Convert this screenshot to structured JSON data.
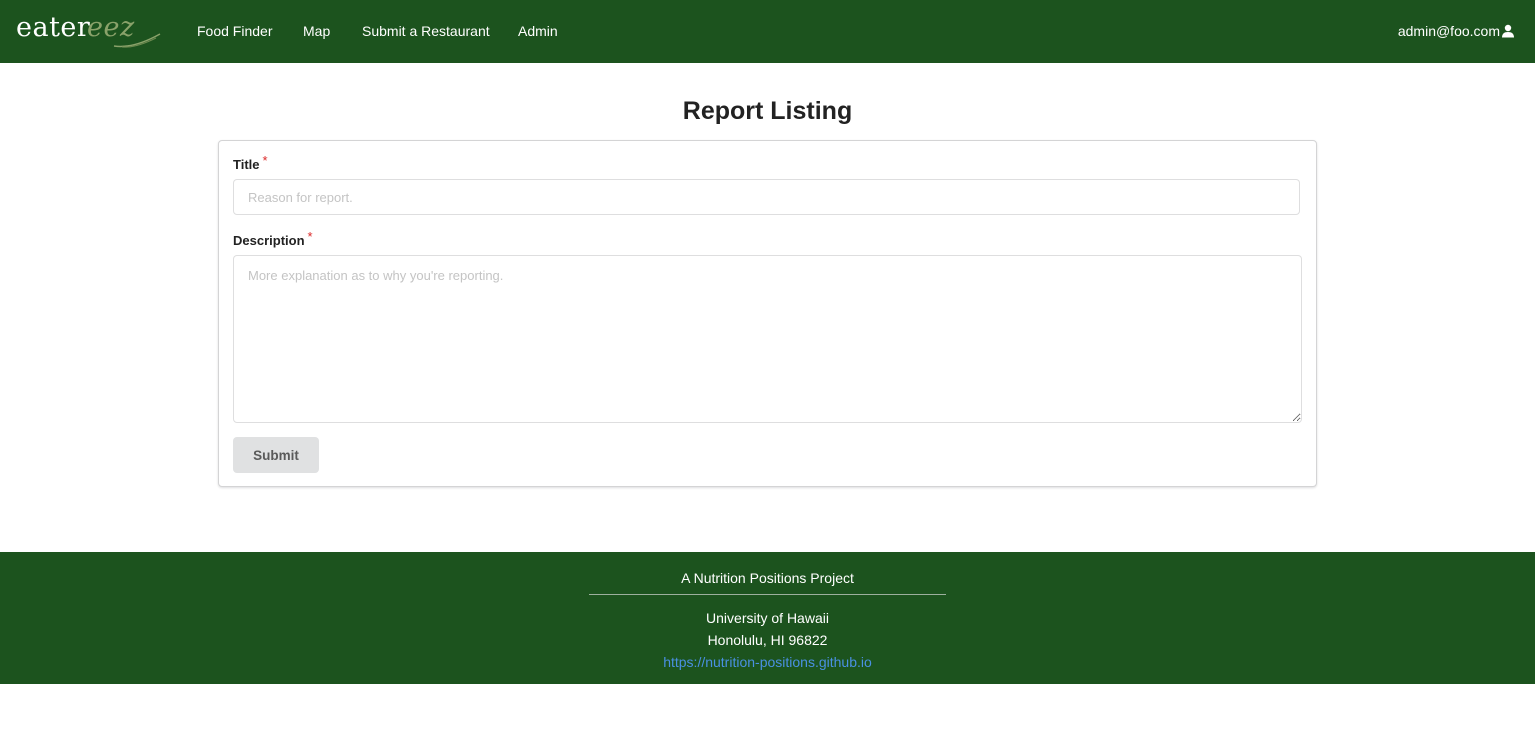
{
  "navbar": {
    "logo_text_main": "eater",
    "logo_text_accent": "eez",
    "links": [
      {
        "label": "Food Finder"
      },
      {
        "label": "Map"
      },
      {
        "label": "Submit a Restaurant"
      },
      {
        "label": "Admin"
      }
    ],
    "user_email": "admin@foo.com",
    "user_icon": "user-icon"
  },
  "page": {
    "title": "Report Listing"
  },
  "form": {
    "title_label": "Title",
    "title_required_mark": "*",
    "title_placeholder": "Reason for report.",
    "title_value": "",
    "description_label": "Description",
    "description_required_mark": "*",
    "description_placeholder": "More explanation as to why you're reporting.",
    "description_value": "",
    "submit_label": "Submit"
  },
  "footer": {
    "project": "A Nutrition Positions Project",
    "university": "University of Hawaii",
    "address": "Honolulu, HI 96822",
    "link": "https://nutrition-positions.github.io"
  },
  "colors": {
    "brand_green": "#1c531e",
    "required_red": "#db2828",
    "link_blue": "#4a90e2",
    "button_gray": "#e0e1e2"
  }
}
